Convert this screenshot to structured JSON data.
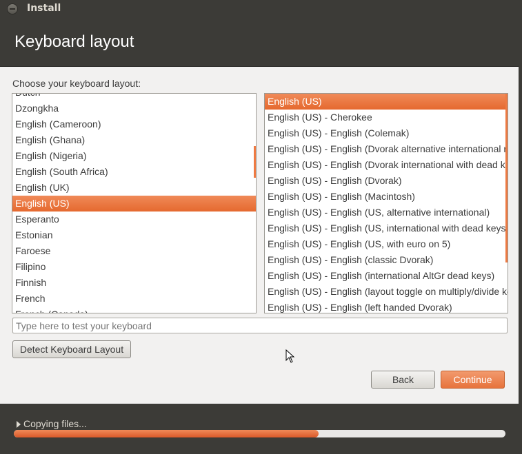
{
  "window": {
    "title": "Install"
  },
  "header": {
    "title": "Keyboard layout"
  },
  "main": {
    "choose_label": "Choose your keyboard layout:",
    "layouts": [
      "Dutch",
      "Dzongkha",
      "English (Cameroon)",
      "English (Ghana)",
      "English (Nigeria)",
      "English (South Africa)",
      "English (UK)",
      "English (US)",
      "Esperanto",
      "Estonian",
      "Faroese",
      "Filipino",
      "Finnish",
      "French",
      "French (Canada)"
    ],
    "layouts_selected": "English (US)",
    "variants": [
      "English (US)",
      "English (US) - Cherokee",
      "English (US) - English (Colemak)",
      "English (US) - English (Dvorak alternative international no dead keys)",
      "English (US) - English (Dvorak international with dead keys)",
      "English (US) - English (Dvorak)",
      "English (US) - English (Macintosh)",
      "English (US) - English (US, alternative international)",
      "English (US) - English (US, international with dead keys)",
      "English (US) - English (US, with euro on 5)",
      "English (US) - English (classic Dvorak)",
      "English (US) - English (international AltGr dead keys)",
      "English (US) - English (layout toggle on multiply/divide key)",
      "English (US) - English (left handed Dvorak)"
    ],
    "variants_selected": "English (US)",
    "test_placeholder": "Type here to test your keyboard",
    "detect_button": "Detect Keyboard Layout",
    "back_button": "Back",
    "continue_button": "Continue"
  },
  "footer": {
    "status": "Copying files...",
    "progress": 0.62
  },
  "colors": {
    "accent": "#ee7a42",
    "chrome": "#3c3b37",
    "background": "#f2f1f0"
  }
}
